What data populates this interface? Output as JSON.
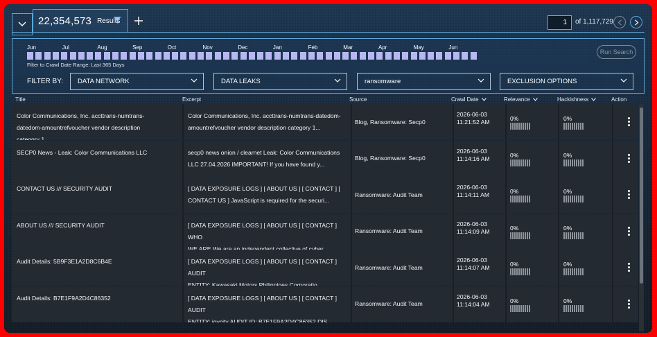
{
  "toolbar": {
    "results_count": "22,354,573",
    "results_label": "Results",
    "page_value": "1",
    "page_of": "of 1,117,729"
  },
  "date_filter": {
    "months": [
      "Jun",
      "Jul",
      "Aug",
      "Sep",
      "Oct",
      "Nov",
      "Dec",
      "Jan",
      "Feb",
      "Mar",
      "Apr",
      "May",
      "Jun"
    ],
    "range_text": "Filter to Crawl Date Range: Last 365 Days",
    "run_search_label": "Run Search",
    "filter_by_label": "FILTER BY:",
    "dropdowns": [
      "DATA NETWORK",
      "DATA LEAKS",
      "ransomware",
      "EXCLUSION OPTIONS"
    ]
  },
  "table": {
    "headers": [
      "Title",
      "Excerpt",
      "Source",
      "Crawl Date",
      "Relevance",
      "Hackishness",
      "Action"
    ],
    "rows": [
      {
        "title": [
          "Color Communications, Inc. accttrans-numtrans-",
          "datedom-amountrefvoucher vendor description",
          "category 1..."
        ],
        "excerpt": [
          "Color Communications, Inc. accttrans-numtrans-datedom-",
          "amountrefvoucher vendor description category 1..."
        ],
        "source": "Blog, Ransomware: Secp0",
        "date": "2026-06-03",
        "time": "11:21:52 AM",
        "relevance": "0%",
        "hackishness": "0%"
      },
      {
        "title": [
          "SECP0 News - Leak: Color Communications LLC"
        ],
        "excerpt": [
          "secp0 news onion / clearnet Leak: Color Communications",
          "LLC 27.04.2026 IMPORTANT! If you have found y..."
        ],
        "source": "Blog, Ransomware: Secp0",
        "date": "2026-06-03",
        "time": "11:14:16 AM",
        "relevance": "0%",
        "hackishness": "0%"
      },
      {
        "title": [
          "CONTACT US /// SECURITY AUDIT"
        ],
        "excerpt": [
          "[ DATA EXPOSURE LOGS ] [ ABOUT US ] [ CONTACT ] [",
          "CONTACT US ] JavaScript is required for the securi..."
        ],
        "source": "Ransomware: Audit Team",
        "date": "2026-06-03",
        "time": "11:14:11 AM",
        "relevance": "0%",
        "hackishness": "0%"
      },
      {
        "title": [
          "ABOUT US /// SECURITY AUDIT"
        ],
        "excerpt": [
          "[ DATA EXPOSURE LOGS ] [ ABOUT US ] [ CONTACT ] WHO",
          "WE ARE We are an independent collective of cyber..."
        ],
        "source": "Ransomware: Audit Team",
        "date": "2026-06-03",
        "time": "11:14:09 AM",
        "relevance": "0%",
        "hackishness": "0%"
      },
      {
        "title": [
          "Audit Details: 5B9F3E1A2D8C6B4E"
        ],
        "excerpt": [
          "[ DATA EXPOSURE LOGS ] [ ABOUT US ] [ CONTACT ] AUDIT",
          "ENTITY: Kawasaki Motors Philippines Corporatio..."
        ],
        "source": "Ransomware: Audit Team",
        "date": "2026-06-03",
        "time": "11:14:07 AM",
        "relevance": "0%",
        "hackishness": "0%"
      },
      {
        "title": [
          "Audit Details: B7E1F9A2D4C86352"
        ],
        "excerpt": [
          "[ DATA EXPOSURE LOGS ] [ ABOUT US ] [ CONTACT ] AUDIT",
          "ENTITY: joycity AUDIT ID: B7E1F9A2D4C86352 DIS..."
        ],
        "source": "Ransomware: Audit Team",
        "date": "2026-06-03",
        "time": "11:14:04 AM",
        "relevance": "0%",
        "hackishness": "0%"
      }
    ]
  },
  "colors": {
    "accent": "#5ba8d8",
    "slider": "#b7b8f2",
    "row_bg": "#242a31",
    "frame_border": "#ff0000"
  },
  "icons": [
    "chevron-down-icon",
    "funnel-icon",
    "plus-icon",
    "chevron-left-icon",
    "chevron-right-icon",
    "kebab-menu-icon"
  ]
}
